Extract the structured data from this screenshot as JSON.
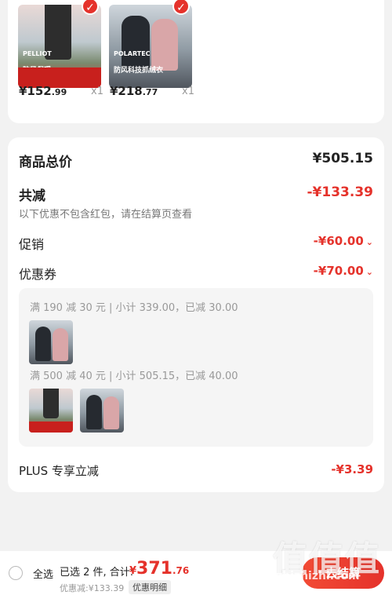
{
  "products": [
    {
      "brand": "PELLIOT",
      "tagline": "防风保暖",
      "price_int": "¥152",
      "price_dec": ".99",
      "qty": "x1"
    },
    {
      "brand": "POLARTEC",
      "tagline": "防风科技抓绒衣",
      "price_int": "¥218",
      "price_dec": ".77",
      "qty": "x1"
    }
  ],
  "summary": {
    "goods_total_label": "商品总价",
    "goods_total_value": "¥505.15",
    "discount_label": "共减",
    "discount_value": "-¥133.39",
    "discount_note": "以下优惠不包含红包，请在结算页查看",
    "promo_label": "促销",
    "promo_value": "-¥60.00",
    "coupon_label": "优惠券",
    "coupon_value": "-¥70.00",
    "coupon_rules": [
      {
        "text": "满 190 减 30 元 | 小计 339.00，已减 30.00"
      },
      {
        "text": "满 500 减 40 元 | 小计 505.15，已减 40.00"
      }
    ],
    "plus_label": "PLUS 专享立减",
    "plus_value": "-¥3.39"
  },
  "bottom_bar": {
    "select_all": "全选",
    "selected_text": "已选 2 件, 合计:",
    "total_currency": "¥",
    "total_int": "371",
    "total_dec": ".76",
    "saved_text": "优惠减:¥133.39",
    "detail_button": "优惠明细",
    "checkout_button": "去结算"
  },
  "watermark": {
    "big": "值值值",
    "small": "zhizhizhi.com"
  },
  "colors": {
    "accent": "#e5322b",
    "muted": "#999999"
  }
}
